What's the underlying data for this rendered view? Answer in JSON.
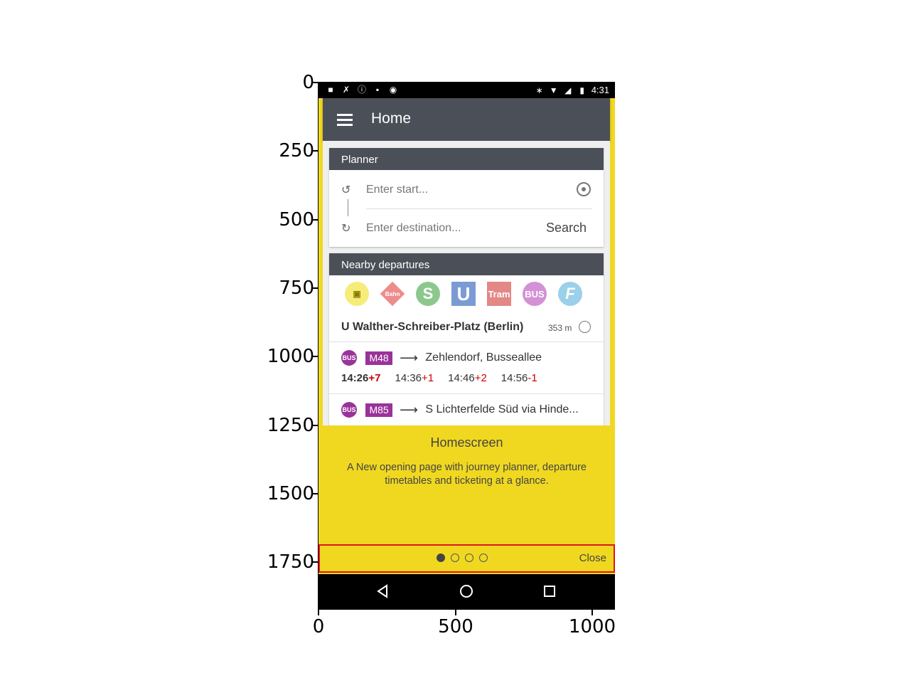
{
  "axes": {
    "y_ticks": [
      "0",
      "250",
      "500",
      "750",
      "1000",
      "1250",
      "1500",
      "1750"
    ],
    "x_ticks": [
      "0",
      "500",
      "1000"
    ]
  },
  "status_bar": {
    "time": "4:31"
  },
  "app_bar": {
    "title": "Home"
  },
  "planner": {
    "header": "Planner",
    "start_placeholder": "Enter start...",
    "destination_placeholder": "Enter destination...",
    "search_label": "Search"
  },
  "nearby": {
    "header": "Nearby departures",
    "modes": [
      {
        "label": "",
        "icon": "tram-icon"
      },
      {
        "label": "Bahn",
        "icon": "bahn-icon"
      },
      {
        "label": "S",
        "icon": "s-bahn-icon"
      },
      {
        "label": "U",
        "icon": "u-bahn-icon"
      },
      {
        "label": "Tram",
        "icon": "tram-text-icon"
      },
      {
        "label": "BUS",
        "icon": "bus-icon"
      },
      {
        "label": "F",
        "icon": "ferry-icon"
      }
    ],
    "stop_name": "U Walther-Schreiber-Platz (Berlin)",
    "stop_distance": "353 m",
    "departures": [
      {
        "badge": "BUS",
        "line": "M48",
        "destination": "Zehlendorf, Busseallee",
        "times": [
          {
            "time": "14:26",
            "delay": "+7"
          },
          {
            "time": "14:36",
            "delay": "+1"
          },
          {
            "time": "14:46",
            "delay": "+2"
          },
          {
            "time": "14:56",
            "delay": "-1"
          }
        ]
      },
      {
        "badge": "BUS",
        "line": "M85",
        "destination": "S Lichterfelde Süd via Hinde..."
      }
    ]
  },
  "intro": {
    "title": "Homescreen",
    "text": "A New opening page with journey planner, departure timetables and ticketing at a glance.",
    "page_count": 4,
    "active_page": 1,
    "close_label": "Close"
  },
  "colors": {
    "yellow": "#f0d821",
    "header_gray": "#4b5058",
    "bus_purple": "#993399",
    "delay_red": "#cc0000",
    "highlight_red": "#e0141e"
  }
}
